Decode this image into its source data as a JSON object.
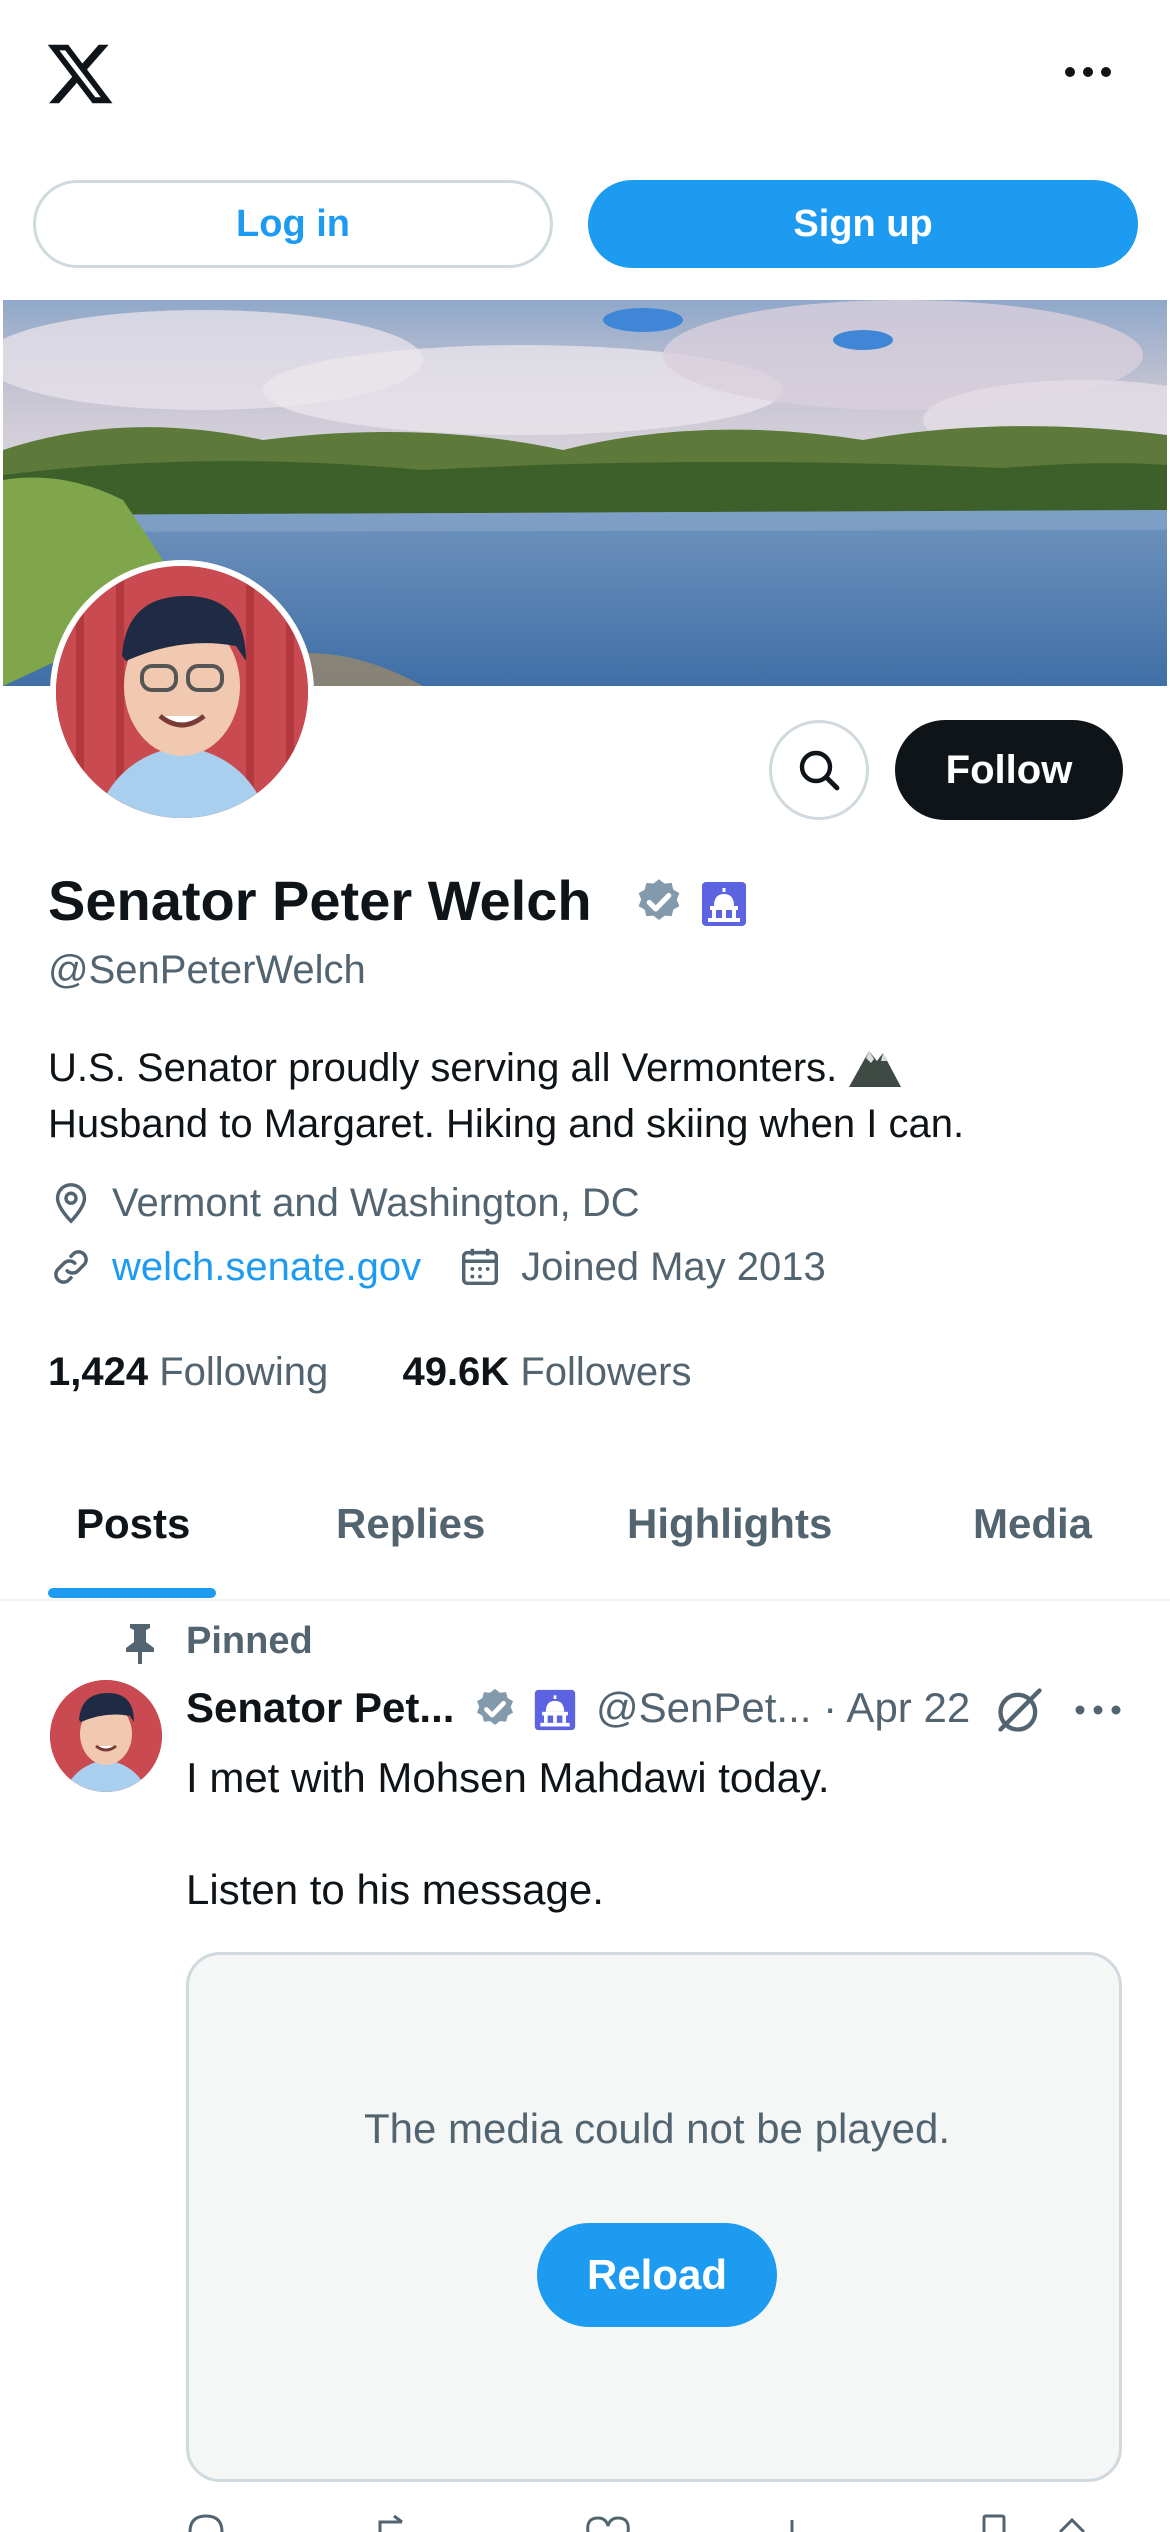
{
  "top_bar": {
    "logo_icon": "x-logo-icon",
    "more_icon": "more-horizontal-icon"
  },
  "auth": {
    "login_label": "Log in",
    "signup_label": "Sign up"
  },
  "profile": {
    "name": "Senator Peter Welch",
    "handle": "@SenPeterWelch",
    "bio_line1": "U.S. Senator proudly serving all Vermonters.",
    "bio_line2": "Husband to Margaret. Hiking and skiing when I can.",
    "location": "Vermont and Washington, DC",
    "website": "welch.senate.gov",
    "joined": "Joined May 2013",
    "following_count": "1,424",
    "following_label": "Following",
    "followers_count": "49.6K",
    "followers_label": "Followers",
    "follow_label": "Follow"
  },
  "tabs": [
    {
      "label": "Posts",
      "active": true
    },
    {
      "label": "Replies",
      "active": false
    },
    {
      "label": "Highlights",
      "active": false
    },
    {
      "label": "Media",
      "active": false
    }
  ],
  "post": {
    "pinned_label": "Pinned",
    "author_name": "Senator Pet...",
    "author_handle": "@SenPet...",
    "date": "· Apr 22",
    "text_line1": "I met with Mohsen Mahdawi today.",
    "text_line2": "Listen to his message.",
    "media_error": "The media could not be played.",
    "reload_label": "Reload"
  },
  "colors": {
    "accent": "#1d9bf0",
    "text_primary": "#0f1419",
    "text_secondary": "#536471",
    "verified_badge": "#829aab"
  }
}
